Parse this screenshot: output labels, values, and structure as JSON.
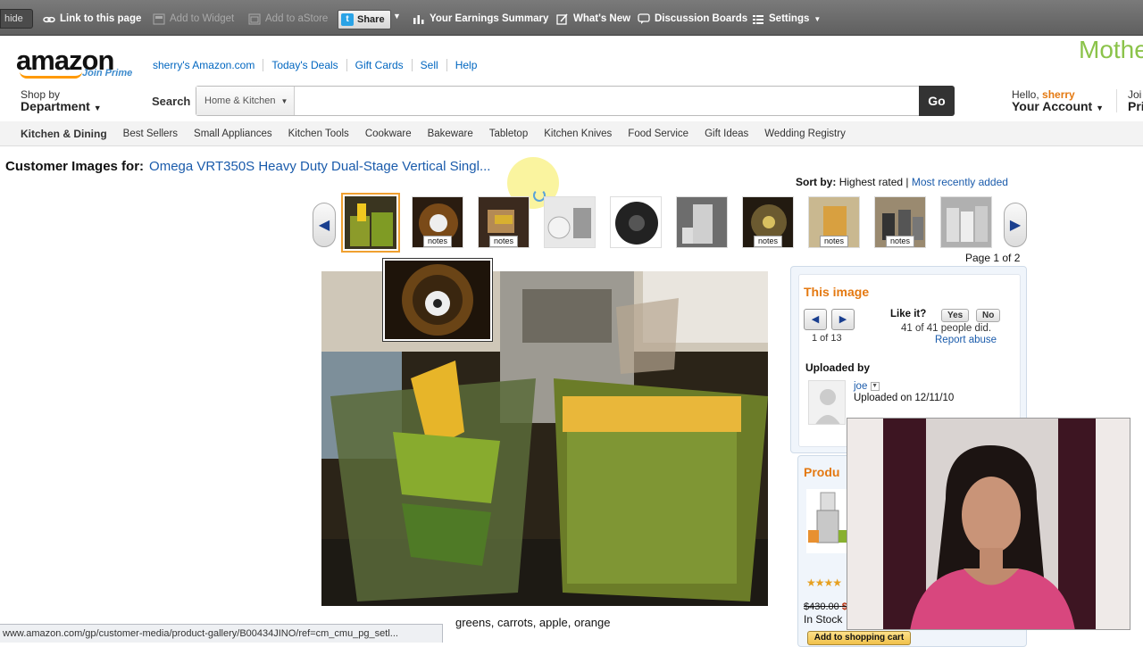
{
  "assoc_bar": {
    "hide": "hide",
    "link_to_page": "Link to this page",
    "add_to_widget": "Add to Widget",
    "add_to_astore": "Add to aStore",
    "share": "Share",
    "earnings": "Your Earnings Summary",
    "whats_new": "What's New",
    "discussion": "Discussion Boards",
    "settings": "Settings"
  },
  "header": {
    "logo": "amazon",
    "join_prime": "Join Prime",
    "links": [
      "sherry's Amazon.com",
      "Today's Deals",
      "Gift Cards",
      "Sell",
      "Help"
    ],
    "mothers": "Mothe",
    "shop_by": "Shop by",
    "department": "Department",
    "search_label": "Search",
    "search_category": "Home & Kitchen",
    "search_value": "",
    "go": "Go",
    "hello": "Hello,",
    "hello_name": "sherry",
    "your_account": "Your Account",
    "join_top": "Joi",
    "join_bottom": "Pri"
  },
  "subnav": [
    "Kitchen & Dining",
    "Best Sellers",
    "Small Appliances",
    "Kitchen Tools",
    "Cookware",
    "Bakeware",
    "Tabletop",
    "Kitchen Knives",
    "Food Service",
    "Gift Ideas",
    "Wedding Registry"
  ],
  "page": {
    "title_prefix": "Customer Images for:",
    "product_name": "Omega VRT350S Heavy Duty Dual-Stage Vertical Singl...",
    "sort_by": "Sort by:",
    "sort_highest": "Highest rated",
    "sort_sep": "|",
    "sort_recent": "Most recently added",
    "notes_label": "notes",
    "page_of": "Page 1 of 2",
    "caption": "greens, carrots, apple, orange"
  },
  "image_panel": {
    "heading": "This image",
    "count": "1 of 13",
    "like_it": "Like it?",
    "yes": "Yes",
    "no": "No",
    "people_did": "41 of 41 people did.",
    "report_abuse": "Report abuse",
    "uploaded_by": "Uploaded by",
    "uploader": "joe",
    "upload_date": "Uploaded on 12/11/10"
  },
  "product_panel": {
    "heading": "Produ",
    "stars": "★★★★",
    "old_price": "$430.00",
    "new_price": "$",
    "in_stock": "In Stock",
    "add_to_cart": "Add to shopping cart"
  },
  "statusbar": "www.amazon.com/gp/customer-media/product-gallery/B00434JINO/ref=cm_cmu_pg_setl...",
  "colors": {
    "amazon_orange": "#e47911",
    "link_blue": "#1a5bab",
    "toolbar_grey": "#6e6e6e",
    "selected_thumb": "#f0a030"
  }
}
